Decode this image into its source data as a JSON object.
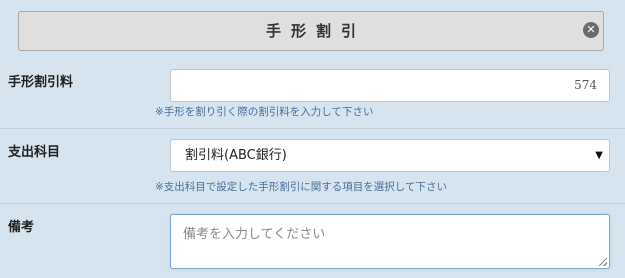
{
  "dialog": {
    "title": "手形割引",
    "close_icon_glyph": "✕"
  },
  "fields": {
    "discount_fee": {
      "label": "手形割引料",
      "value": "574",
      "hint": "※手形を割り引く際の割引料を入力して下さい"
    },
    "expense_account": {
      "label": "支出科目",
      "selected": "割引料(ABC銀行)",
      "arrow_glyph": "▼",
      "hint": "※支出科目で設定した手形割引に関する項目を選択して下さい"
    },
    "remarks": {
      "label": "備考",
      "value": "",
      "placeholder": "備考を入力してください"
    }
  },
  "colors": {
    "background": "#d5e4ee",
    "title_bar": "#dfdfdf",
    "hint_text": "#4a6f9a",
    "focus_border": "#7fa7cf"
  }
}
